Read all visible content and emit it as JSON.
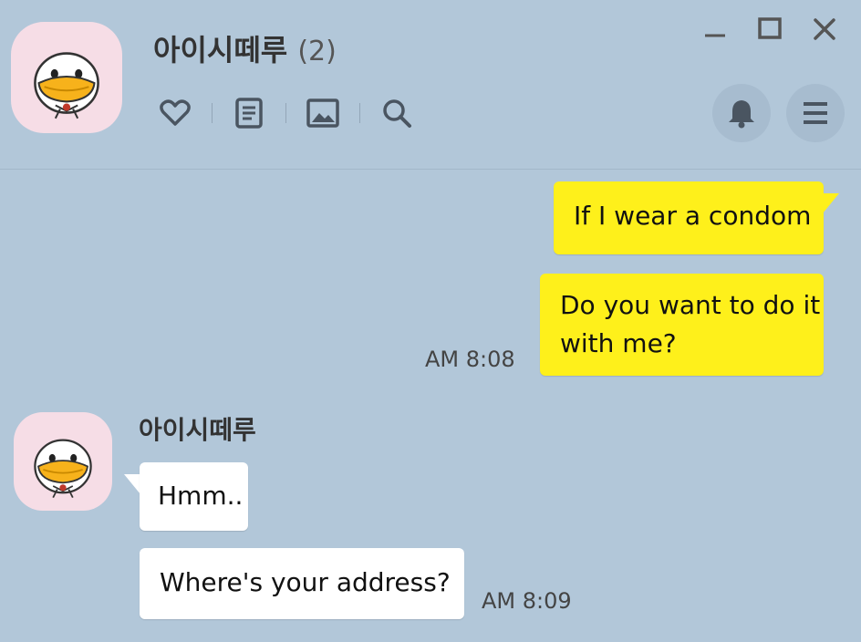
{
  "chat": {
    "name": "아이시떼루",
    "member_count": "(2)"
  },
  "toolbar": {
    "icons": [
      "heart-icon",
      "notes-icon",
      "album-icon",
      "search-icon"
    ]
  },
  "window_controls": [
    "minimize-icon",
    "maximize-icon",
    "close-icon"
  ],
  "header_actions": [
    "bell-icon",
    "menu-icon"
  ],
  "colors": {
    "background": "#b2c7d9",
    "my_bubble": "#fef01b",
    "their_bubble": "#ffffff",
    "avatar_bg": "#f6dde6"
  },
  "messages": {
    "outgoing": [
      {
        "text": "If I wear a condom"
      },
      {
        "line1": "Do you want to do it",
        "line2": "with me?",
        "time": "AM 8:08"
      }
    ],
    "incoming": {
      "sender": "아이시떼루",
      "items": [
        {
          "text": "Hmm.."
        },
        {
          "text": "Where's your address?",
          "time": "AM 8:09"
        }
      ]
    }
  }
}
